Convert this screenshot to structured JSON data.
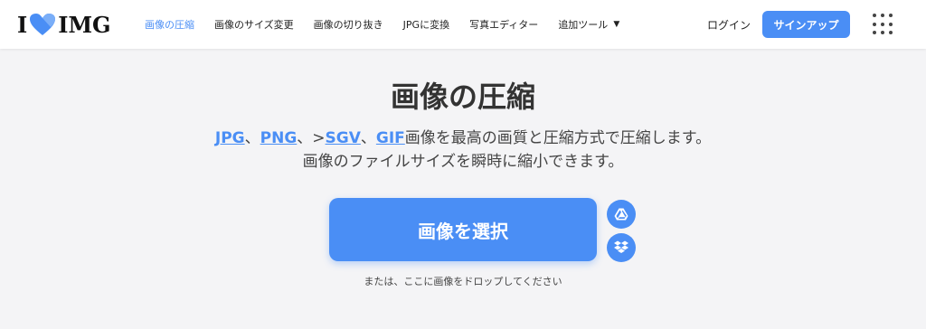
{
  "header": {
    "logo": {
      "left": "I",
      "right": "IMG"
    },
    "nav": [
      {
        "label": "画像の圧縮",
        "active": true
      },
      {
        "label": "画像のサイズ変更"
      },
      {
        "label": "画像の切り抜き"
      },
      {
        "label": "JPGに変換"
      },
      {
        "label": "写真エディター"
      },
      {
        "label": "追加ツール",
        "dropdown": true
      }
    ],
    "login": "ログイン",
    "signup": "サインアップ"
  },
  "main": {
    "title": "画像の圧縮",
    "formats": [
      "JPG",
      "PNG",
      "SGV",
      "GIF"
    ],
    "sep1": "、",
    "sep2": "、>",
    "sep3": "、",
    "subtitle_rest": "画像を最高の画質と圧縮方式で圧縮します。",
    "subtitle_line2": "画像のファイルサイズを瞬時に縮小できます。",
    "select_button": "画像を選択",
    "drop_hint": "または、ここに画像をドロップしてください"
  },
  "colors": {
    "accent": "#4a8ef5",
    "heart": "#4a8ef5"
  },
  "icons": [
    "heart-logo-icon",
    "caret-down-icon",
    "apps-grid-icon",
    "google-drive-icon",
    "dropbox-icon"
  ]
}
